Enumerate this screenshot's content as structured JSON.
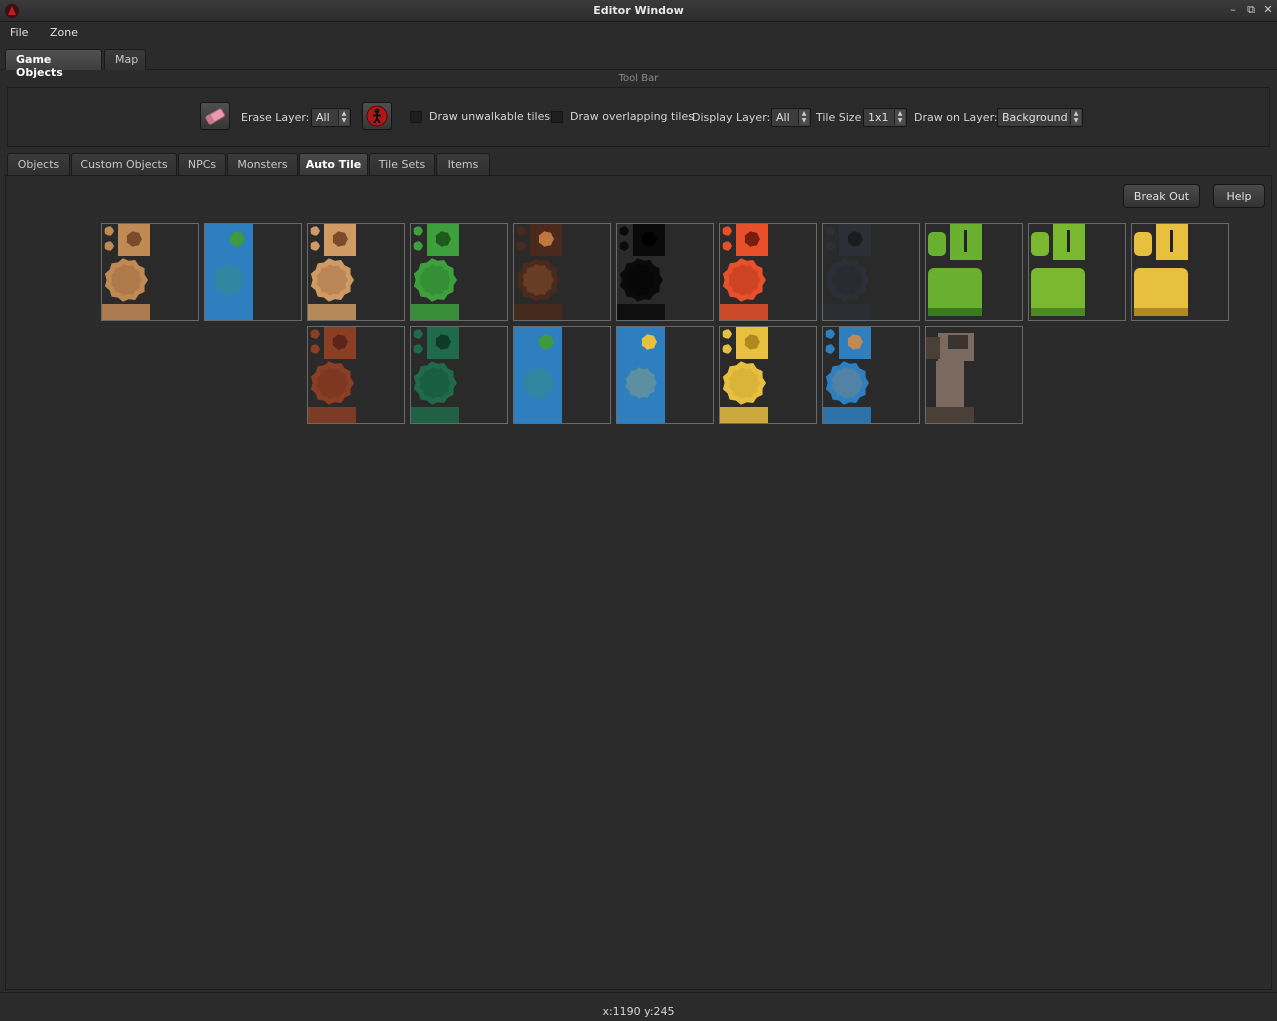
{
  "window": {
    "title": "Editor Window"
  },
  "menu": {
    "items": [
      "File",
      "Zone"
    ]
  },
  "main_tabs": [
    {
      "label": "Game Objects",
      "active": true
    },
    {
      "label": "Map",
      "active": false
    }
  ],
  "toolbar": {
    "title": "Tool Bar",
    "erase_layer_label": "Erase Layer:",
    "erase_layer_value": "All",
    "draw_unwalkable_label": "Draw unwalkable tiles",
    "draw_overlapping_label": "Draw overlapping tiles",
    "display_layer_label": "Display Layer:",
    "display_layer_value": "All",
    "tile_size_label": "Tile Size",
    "tile_size_value": "1x1",
    "draw_on_layer_label": "Draw on Layer:",
    "draw_on_layer_value": "Background"
  },
  "sub_tabs": [
    {
      "label": "Objects",
      "active": false
    },
    {
      "label": "Custom Objects",
      "active": false
    },
    {
      "label": "NPCs",
      "active": false
    },
    {
      "label": "Monsters",
      "active": false
    },
    {
      "label": "Auto Tile",
      "active": true
    },
    {
      "label": "Tile Sets",
      "active": false
    },
    {
      "label": "Items",
      "active": false
    }
  ],
  "buttons": {
    "break_out": "Break Out",
    "help": "Help"
  },
  "autotiles": [
    {
      "id": "dirt-light",
      "style": "blob",
      "base": "#c08a55",
      "dark": "#7a4a2a",
      "bg": "#2a2a2a"
    },
    {
      "id": "water-grass",
      "style": "blob",
      "base": "#2e7fc0",
      "dark": "#3d9a3d",
      "bg": "#2e7fc0"
    },
    {
      "id": "dirt-sand",
      "style": "blob",
      "base": "#cf9a63",
      "dark": "#7a4a2a",
      "bg": "#2a2a2a"
    },
    {
      "id": "grass",
      "style": "blob",
      "base": "#3da03d",
      "dark": "#1e5a1e",
      "bg": "#2a2a2a"
    },
    {
      "id": "dark-soil",
      "style": "blob",
      "base": "#4a2a1c",
      "dark": "#c07840",
      "bg": "#2a2a2a"
    },
    {
      "id": "void",
      "style": "blob",
      "base": "#0a0a0a",
      "dark": "#000000",
      "bg": "#2a2a2a"
    },
    {
      "id": "lava",
      "style": "blob",
      "base": "#e8502a",
      "dark": "#7a1c10",
      "bg": "#2a2a2a"
    },
    {
      "id": "dark-stone",
      "style": "blob",
      "base": "#2c3036",
      "dark": "#1a1c20",
      "bg": "#2a2a2a"
    },
    {
      "id": "tall-grass-green",
      "style": "cliff",
      "base": "#6ab030",
      "dark": "#3a7a1a",
      "bg": "#2a2a2a"
    },
    {
      "id": "light-grass",
      "style": "cliff",
      "base": "#7ab830",
      "dark": "#4a8a20",
      "bg": "#2a2a2a"
    },
    {
      "id": "hay",
      "style": "cliff",
      "base": "#e8c040",
      "dark": "#b08a20",
      "bg": "#2a2a2a"
    },
    {
      "id": "red-dirt",
      "style": "blob",
      "base": "#8a3e24",
      "dark": "#5a2416",
      "bg": "#2a2a2a"
    },
    {
      "id": "dark-green",
      "style": "blob",
      "base": "#1e6a4a",
      "dark": "#0e3a2a",
      "bg": "#2a2a2a"
    },
    {
      "id": "pond-grass",
      "style": "blob",
      "base": "#2e7fc0",
      "dark": "#3d9a3d",
      "bg": "#2e7fc0"
    },
    {
      "id": "water-sand",
      "style": "blob",
      "base": "#2e7fc0",
      "dark": "#e8c040",
      "bg": "#2e7fc0"
    },
    {
      "id": "sand",
      "style": "blob",
      "base": "#e8c040",
      "dark": "#b08a20",
      "bg": "#2a2a2a"
    },
    {
      "id": "water-dirt",
      "style": "blob",
      "base": "#2e7fc0",
      "dark": "#c08a55",
      "bg": "#2a2a2a"
    },
    {
      "id": "stone-wall",
      "style": "wall",
      "base": "#7a6a60",
      "dark": "#4a4038",
      "bg": "#2a2a2a"
    }
  ],
  "status": {
    "coords": "x:1190 y:245"
  }
}
